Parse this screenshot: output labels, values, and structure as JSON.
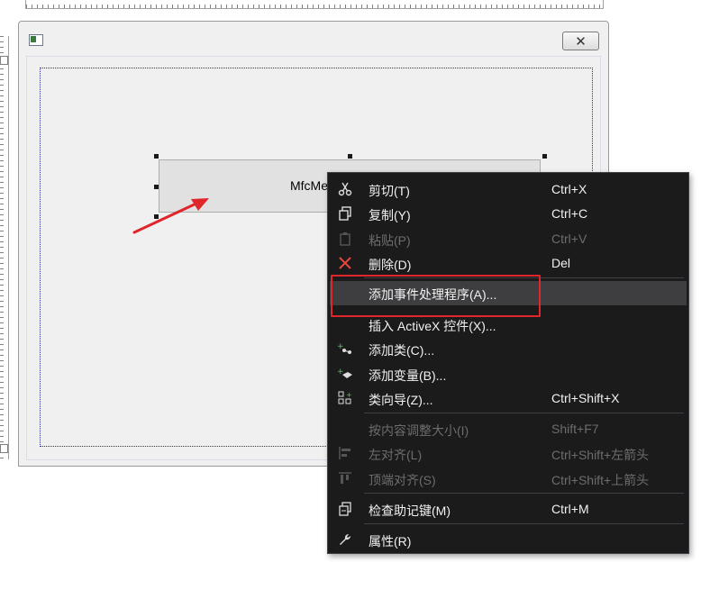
{
  "dialog": {
    "button_text": "MfcMe",
    "close_glyph": "✕"
  },
  "menu": {
    "items": [
      {
        "label": "剪切(T)",
        "shortcut": "Ctrl+X",
        "icon": "scissors-icon",
        "disabled": false
      },
      {
        "label": "复制(Y)",
        "shortcut": "Ctrl+C",
        "icon": "copy-icon",
        "disabled": false
      },
      {
        "label": "粘贴(P)",
        "shortcut": "Ctrl+V",
        "icon": "paste-icon",
        "disabled": true
      },
      {
        "label": "删除(D)",
        "shortcut": "Del",
        "icon": "delete-x-icon",
        "disabled": false
      },
      {
        "label": "添加事件处理程序(A)...",
        "shortcut": "",
        "icon": "",
        "disabled": false
      },
      {
        "label": "插入 ActiveX 控件(X)...",
        "shortcut": "",
        "icon": "",
        "disabled": false
      },
      {
        "label": "添加类(C)...",
        "shortcut": "",
        "icon": "add-class-icon",
        "disabled": false
      },
      {
        "label": "添加变量(B)...",
        "shortcut": "",
        "icon": "add-variable-icon",
        "disabled": false
      },
      {
        "label": "类向导(Z)...",
        "shortcut": "Ctrl+Shift+X",
        "icon": "class-wizard-icon",
        "disabled": false
      },
      {
        "label": "按内容调整大小(I)",
        "shortcut": "Shift+F7",
        "icon": "",
        "disabled": true
      },
      {
        "label": "左对齐(L)",
        "shortcut": "Ctrl+Shift+左箭头",
        "icon": "align-left-icon",
        "disabled": true
      },
      {
        "label": "顶端对齐(S)",
        "shortcut": "Ctrl+Shift+上箭头",
        "icon": "align-top-icon",
        "disabled": true
      },
      {
        "label": "检查助记键(M)",
        "shortcut": "Ctrl+M",
        "icon": "check-mnemonics-icon",
        "disabled": false
      },
      {
        "label": "属性(R)",
        "shortcut": "",
        "icon": "wrench-icon",
        "disabled": false
      }
    ]
  },
  "colors": {
    "menu_bg": "#1b1b1c",
    "highlight_border": "#e0262b",
    "delete_icon": "#e8473e"
  }
}
